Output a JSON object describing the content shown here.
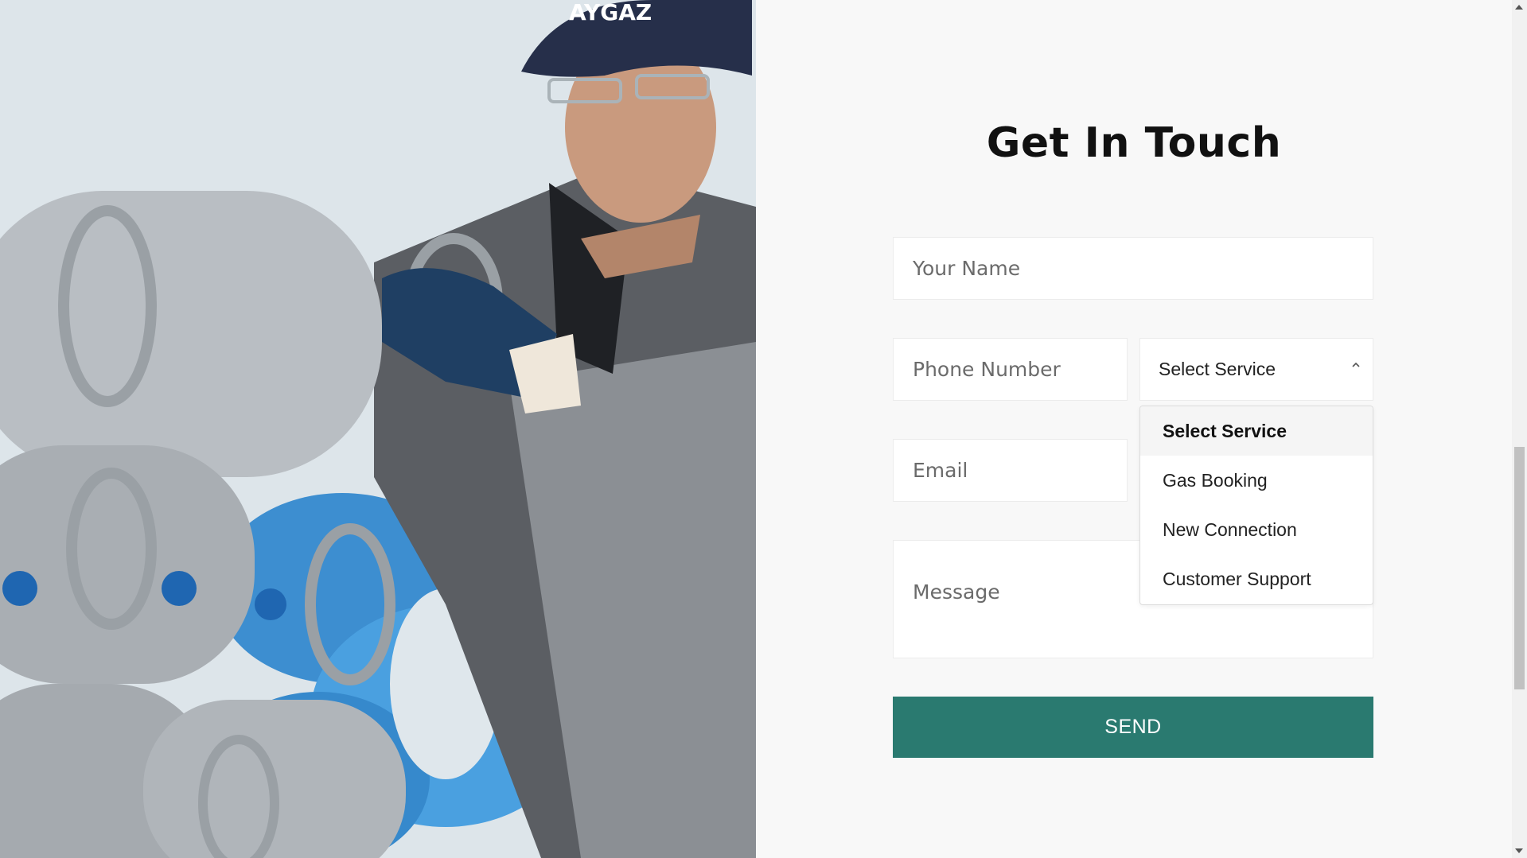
{
  "hero": {
    "image_label": "Worker in cap and gloves carrying LPG gas cylinders",
    "cap_text": "AYGAZ"
  },
  "form": {
    "title": "Get In Touch",
    "name_placeholder": "Your Name",
    "phone_placeholder": "Phone Number",
    "email_placeholder": "Email",
    "message_placeholder": "Message",
    "service_select": {
      "selected": "Select Service",
      "options": [
        {
          "label": "Select Service",
          "selected": true
        },
        {
          "label": "Gas Booking",
          "selected": false
        },
        {
          "label": "New Connection",
          "selected": false
        },
        {
          "label": "Customer Support",
          "selected": false
        }
      ]
    },
    "send_label": "SEND"
  },
  "colors": {
    "accent": "#2a7a70",
    "page_bg": "#f8f8f8",
    "field_bg": "#ffffff"
  }
}
